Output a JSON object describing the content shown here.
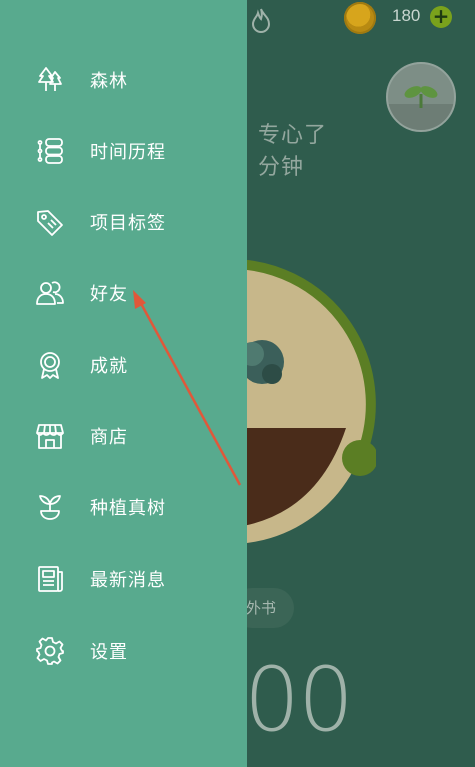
{
  "header": {
    "coin_count": "180",
    "coin_icon": "coin-icon",
    "add_icon": "plus-icon",
    "streak_icon": "fire-icon"
  },
  "main": {
    "motivation_line1": "专心了",
    "motivation_line2": "分钟",
    "tag_label": "外书",
    "timer": "00"
  },
  "drawer": {
    "items": [
      {
        "label": "森林",
        "icon": "forest-icon"
      },
      {
        "label": "时间历程",
        "icon": "timeline-icon"
      },
      {
        "label": "项目标签",
        "icon": "tag-icon"
      },
      {
        "label": "好友",
        "icon": "friends-icon"
      },
      {
        "label": "成就",
        "icon": "achievement-icon"
      },
      {
        "label": "商店",
        "icon": "store-icon"
      },
      {
        "label": "种植真树",
        "icon": "plant-real-tree-icon"
      },
      {
        "label": "最新消息",
        "icon": "news-icon"
      },
      {
        "label": "设置",
        "icon": "settings-icon"
      }
    ]
  },
  "colors": {
    "drawer_bg": "#58aa8e",
    "app_bg": "#2f5c4d",
    "annotation_arrow": "#e0583a"
  }
}
